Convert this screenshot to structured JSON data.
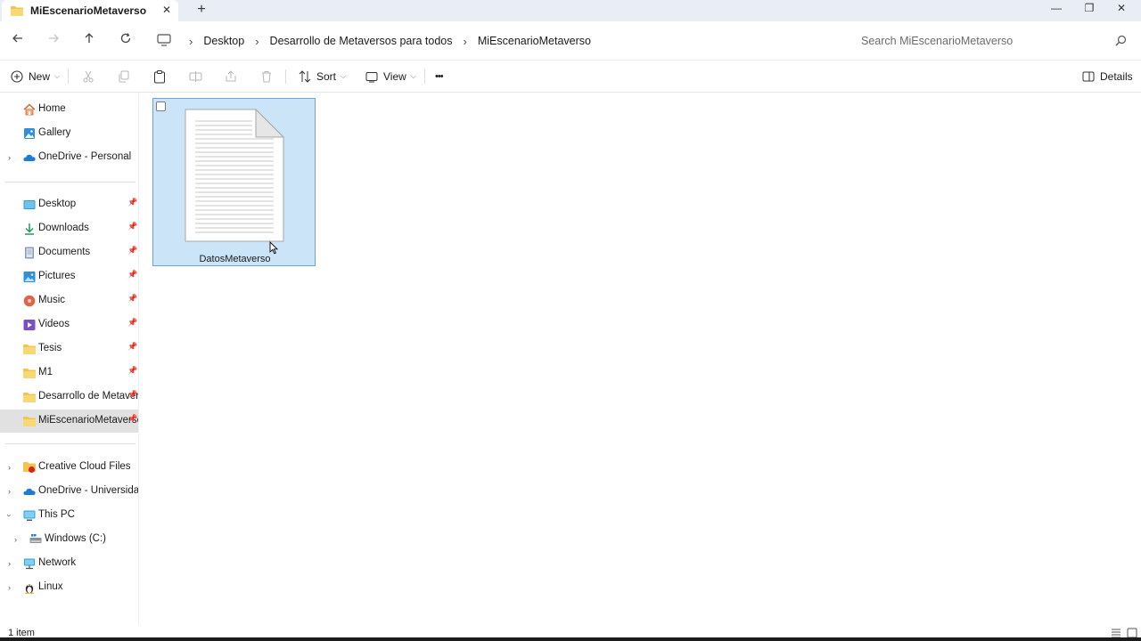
{
  "tab": {
    "title": "MiEscenarioMetaverso",
    "close": "✕",
    "new_tab": "+"
  },
  "window_controls": {
    "minimize": "—",
    "maximize": "❐",
    "close": "✕"
  },
  "breadcrumb": {
    "items": [
      "Desktop",
      "Desarrollo de Metaversos para todos",
      "MiEscenarioMetaverso"
    ],
    "separator": "›"
  },
  "search": {
    "placeholder": "Search MiEscenarioMetaverso"
  },
  "commands": {
    "new_label": "New",
    "sort_label": "Sort",
    "view_label": "View",
    "more_label": "•••",
    "details_label": "Details"
  },
  "sidebar": {
    "quick": [
      {
        "label": "Home",
        "icon": "home-icon"
      },
      {
        "label": "Gallery",
        "icon": "gallery-icon"
      },
      {
        "label": "OneDrive - Personal",
        "icon": "onedrive-icon"
      }
    ],
    "pinned": [
      {
        "label": "Desktop",
        "icon": "desktop-icon"
      },
      {
        "label": "Downloads",
        "icon": "download-icon"
      },
      {
        "label": "Documents",
        "icon": "documents-icon"
      },
      {
        "label": "Pictures",
        "icon": "pictures-icon"
      },
      {
        "label": "Music",
        "icon": "music-icon"
      },
      {
        "label": "Videos",
        "icon": "videos-icon"
      },
      {
        "label": "Tesis",
        "icon": "folder-icon"
      },
      {
        "label": "M1",
        "icon": "folder-icon"
      },
      {
        "label": "Desarrollo de Metaver",
        "icon": "folder-icon"
      },
      {
        "label": "MiEscenarioMetaversc",
        "icon": "folder-icon",
        "selected": true
      }
    ],
    "locations": [
      {
        "label": "Creative Cloud Files",
        "icon": "creative-cloud-icon"
      },
      {
        "label": "OneDrive - Universidad d",
        "icon": "onedrive-icon"
      },
      {
        "label": "This PC",
        "icon": "pc-icon",
        "expanded": true
      },
      {
        "label": "Windows (C:)",
        "icon": "drive-icon"
      },
      {
        "label": "Network",
        "icon": "network-icon"
      },
      {
        "label": "Linux",
        "icon": "linux-icon"
      }
    ],
    "pin_glyph": "📌"
  },
  "files": [
    {
      "name": "DatosMetaverso",
      "type": "text-document",
      "selected": true
    }
  ],
  "status": {
    "item_count": "1 item"
  },
  "colors": {
    "selection_fill": "#cce4f7",
    "selection_border": "#6aa6d8",
    "folder_yellow": "#f3c44b",
    "onedrive_blue": "#1f7ad8",
    "titlebar_bg": "#e9edf5"
  }
}
